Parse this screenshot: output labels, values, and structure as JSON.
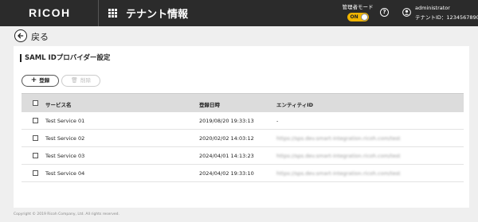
{
  "header": {
    "logo": "RICOH",
    "title": "テナント情報",
    "admin_mode_label": "管理者モード",
    "admin_toggle": "ON",
    "help": "?",
    "user_name": "administrator",
    "tenant_id": "テナントID：1234567890",
    "accent_color": "#f0b400"
  },
  "back_label": "戻る",
  "section_title": "SAML IDプロバイダー設定",
  "toolbar": {
    "add_label": "登録",
    "delete_label": "削除"
  },
  "table": {
    "columns": [
      "サービス名",
      "登録日時",
      "エンティティID"
    ],
    "rows": [
      {
        "name": "Test Service 01",
        "date": "2019/08/20 19:33:13",
        "entity": "-"
      },
      {
        "name": "Test Service 02",
        "date": "2020/02/02 14:03:12",
        "entity": "https://sps.dev.smart-integration.ricoh.com/test"
      },
      {
        "name": "Test Service 03",
        "date": "2024/04/01 14:13:23",
        "entity": "https://sps.dev.smart-integration.ricoh.com/test"
      },
      {
        "name": "Test Service 04",
        "date": "2024/04/02 19:33:10",
        "entity": "https://sps.dev.smart-integration.ricoh.com/test"
      }
    ]
  },
  "footer": "Copyright © 2019 Ricoh Company, Ltd. All rights reserved."
}
